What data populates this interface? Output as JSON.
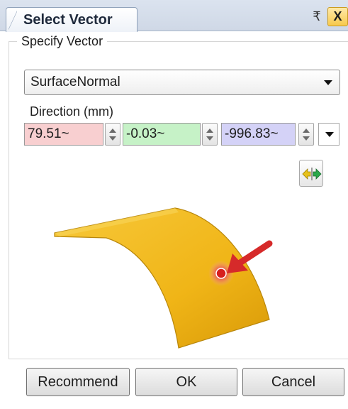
{
  "window": {
    "tab_title": "Select Vector",
    "pin_symbol": "₹",
    "close_symbol": "X",
    "pin_icon": "pin-dropdown-icon",
    "close_icon": "close-icon"
  },
  "vector_group": {
    "title": "Specify Vector",
    "method": "SurfaceNormal",
    "direction_label": "Direction (mm)",
    "x": "79.51~",
    "y": "-0.03~",
    "z": "-996.83~",
    "x_color": "#f8cfd0",
    "y_color": "#c6f2c7",
    "z_color": "#d4d2f7",
    "reverse_icon": "reverse-direction-icon"
  },
  "preview": {
    "surface_color": "#f0b517",
    "vector_color": "#d62a2a"
  },
  "buttons": {
    "recommend": "Recommend",
    "ok": "OK",
    "cancel": "Cancel"
  }
}
